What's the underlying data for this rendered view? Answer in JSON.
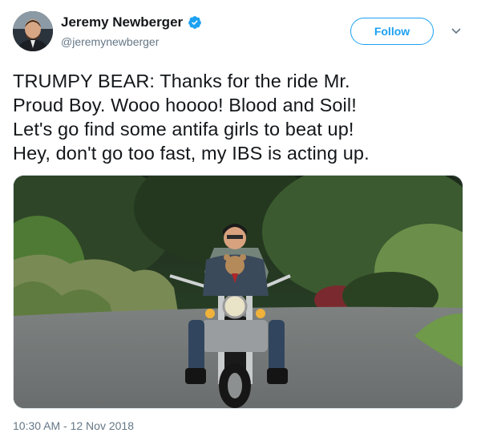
{
  "author": {
    "display_name": "Jeremy Newberger",
    "handle": "@jeremynewberger",
    "verified_icon": "verified-badge-icon",
    "avatar_icon": "profile-avatar"
  },
  "actions": {
    "follow_label": "Follow",
    "more_icon": "chevron-down-icon"
  },
  "tweet": {
    "text": "TRUMPY BEAR: Thanks for the ride Mr.\nProud Boy. Wooo hoooo! Blood and Soil!\nLet's go find some antifa girls to beat up!\nHey, don't go too fast, my IBS is acting up.",
    "media_description_icon": "motorcycle-rider-video-still",
    "timestamp": "10:30 AM - 12 Nov 2018"
  },
  "colors": {
    "accent": "#1da1f2",
    "text": "#14171a",
    "secondary": "#657786"
  }
}
